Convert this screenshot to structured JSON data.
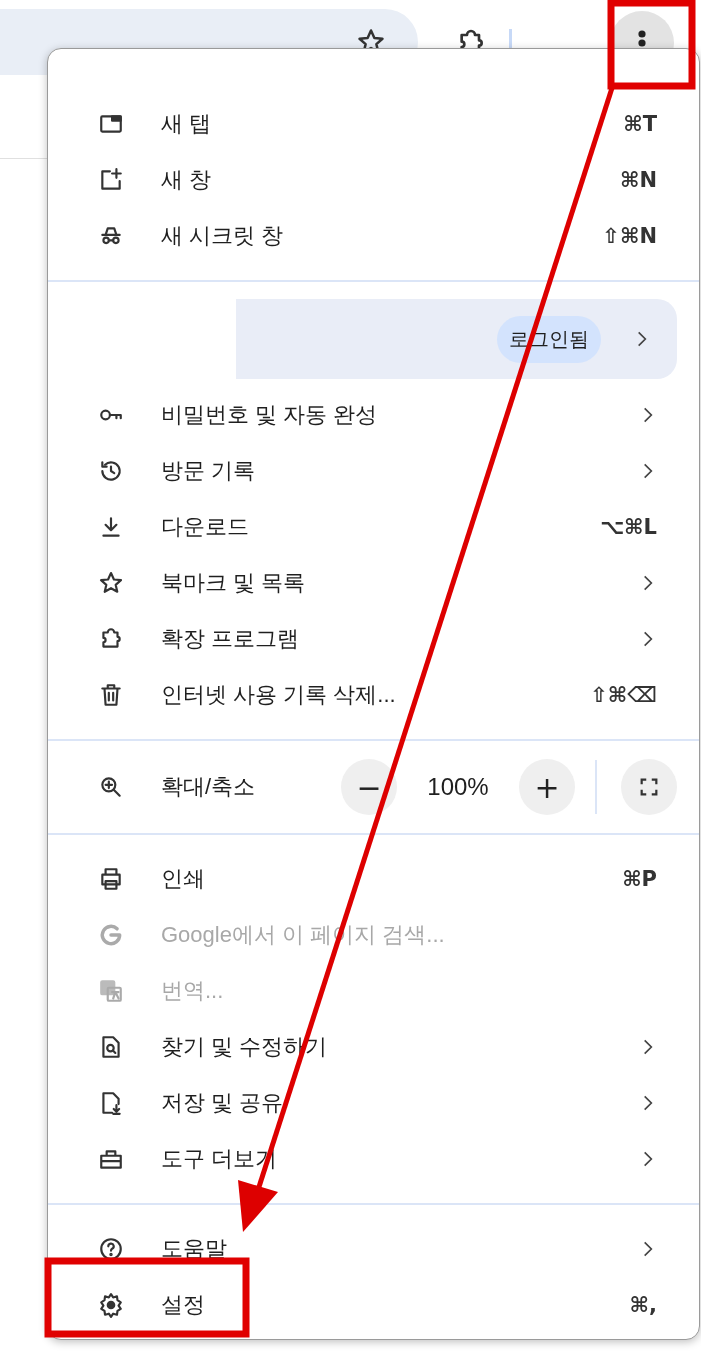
{
  "menu": {
    "sections": [
      {
        "kind": "items",
        "items": [
          {
            "label": "새 탭",
            "shortcut": "⌘T",
            "submenu": false,
            "disabled": false
          },
          {
            "label": "새 창",
            "shortcut": "⌘N",
            "submenu": false,
            "disabled": false
          },
          {
            "label": "새 시크릿 창",
            "shortcut": "⇧⌘N",
            "submenu": false,
            "disabled": false
          }
        ]
      },
      {
        "kind": "items",
        "profile": {
          "chip": "로그인됨",
          "submenu": true
        },
        "items": [
          {
            "label": "비밀번호 및 자동 완성",
            "submenu": true,
            "disabled": false
          },
          {
            "label": "방문 기록",
            "submenu": true,
            "disabled": false
          },
          {
            "label": "다운로드",
            "shortcut": "⌥⌘L",
            "submenu": false,
            "disabled": false
          },
          {
            "label": "북마크 및 목록",
            "submenu": true,
            "disabled": false
          },
          {
            "label": "확장 프로그램",
            "submenu": true,
            "disabled": false
          },
          {
            "label": "인터넷 사용 기록 삭제...",
            "shortcut": "⇧⌘⌫",
            "submenu": false,
            "disabled": false
          }
        ]
      },
      {
        "kind": "zoom",
        "label": "확대/축소",
        "minus": "−",
        "value": "100%",
        "plus": "+"
      },
      {
        "kind": "items",
        "items": [
          {
            "label": "인쇄",
            "shortcut": "⌘P",
            "submenu": false,
            "disabled": false
          },
          {
            "label": "Google에서 이 페이지 검색...",
            "submenu": false,
            "disabled": true
          },
          {
            "label": "번역...",
            "submenu": false,
            "disabled": true
          },
          {
            "label": "찾기 및 수정하기",
            "submenu": true,
            "disabled": false
          },
          {
            "label": "저장 및 공유",
            "submenu": true,
            "disabled": false
          },
          {
            "label": "도구 더보기",
            "submenu": true,
            "disabled": false
          }
        ]
      },
      {
        "kind": "items",
        "items": [
          {
            "label": "도움말",
            "submenu": true,
            "disabled": false
          },
          {
            "label": "설정",
            "shortcut": "⌘,",
            "submenu": false,
            "disabled": false
          }
        ]
      }
    ]
  }
}
